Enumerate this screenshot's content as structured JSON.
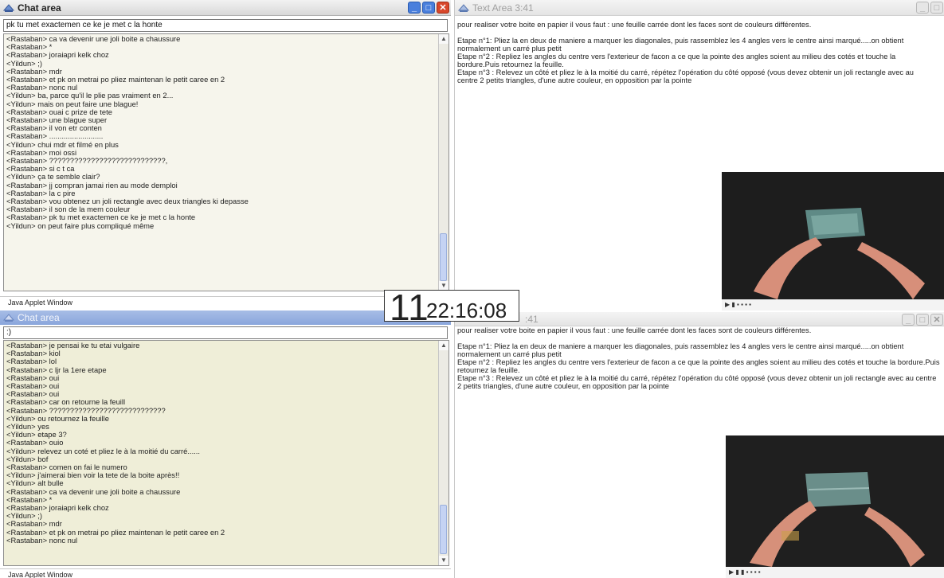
{
  "chat_top": {
    "title": "Chat area",
    "input_value": "pk tu met exactemen ce ke je met c la honte",
    "messages": [
      "<Rastaban> ca va devenir une joli boite a chaussure",
      "<Rastaban> *",
      "<Rastaban> joraiapri kelk choz",
      "<Yildun> ;)",
      "<Rastaban> mdr",
      "<Rastaban> et pk on metrai po pliez maintenan le petit caree en 2",
      "<Rastaban> nonc nul",
      "<Yildun> ba, parce qu'il le plie pas vraiment en 2...",
      "<Yildun> mais on peut faire une blague!",
      "<Rastaban> ouai c prize de tete",
      "<Rastaban> une blague super",
      "<Rastaban> il von etr conten",
      "<Rastaban> ..........................",
      "<Yildun> chui mdr et filmé en plus",
      "<Rastaban> moi ossi",
      "<Rastaban> ????????????????????????????,",
      "<Rastaban> si c t ca",
      "<Yildun> ça te semble clair?",
      "<Rastaban> jj compran jamai rien au mode demploi",
      "<Rastaban> la c pire",
      "<Rastaban> vou obtenez un joli rectangle avec deux triangles ki depasse",
      "<Rastaban> il son de la mem couleur",
      "<Rastaban> pk tu met exactemen ce ke je met c la honte",
      "<Yildun> on peut faire plus compliqué même"
    ],
    "status": "Java Applet Window"
  },
  "chat_bottom": {
    "title": "Chat area",
    "input_value": ":)",
    "messages": [
      "<Rastaban> je pensai ke tu etai vulgaire",
      "<Rastaban> kiol",
      "<Rastaban> lol",
      "<Rastaban> c ljr la 1ere etape",
      "<Rastaban> oui",
      "<Rastaban> oui",
      "<Rastaban> oui",
      "<Rastaban> car on retourne la feuill",
      "<Rastaban> ????????????????????????????",
      "<Yildun> ou retournez la feuille",
      "<Yildun> yes",
      "<Yildun> etape 3?",
      "<Rastaban> ouio",
      "<Yildun> relevez un coté et pliez le à la moitié du carré......",
      "<Yildun> bof",
      "<Rastaban> comen on fai le numero",
      "<Yildun> j'aimerai bien voir la tete de la boite après!!",
      "<Yildun> alt bulle",
      "<Rastaban> ca va devenir une joli boite a chaussure",
      "<Rastaban> *",
      "<Rastaban> joraiapri kelk choz",
      "<Yildun> ;)",
      "<Rastaban> mdr",
      "<Rastaban> et pk on metrai po pliez maintenan le petit caree en 2",
      "<Rastaban> nonc nul"
    ],
    "status": "Java Applet Window"
  },
  "text_top": {
    "title": "Text Area 3:41",
    "paragraphs": [
      "pour realiser votre boite en papier il vous faut : une feuille carrée dont les faces sont de couleurs différentes.",
      "",
      "Etape n°1: Pliez  la en deux de maniere a marquer les diagonales, puis rassemblez les 4 angles vers le centre ainsi marqué.....on obtient normalement un carré plus petit",
      "Etape n°2 : Repliez les angles du centre vers l'exterieur de facon a ce que la pointe des angles soient au milieu des cotés  et touche la bordure.Puis retournez la feuille.",
      "Etape n°3 : Relevez un côté et pliez le à la moitié du carré, répétez l'opération du côté opposé (vous devez obtenir un joli rectangle avec au centre 2 petits triangles, d'une autre couleur, en opposition par la pointe"
    ]
  },
  "text_bottom": {
    "title_fragment": ":41",
    "paragraphs": [
      "pour realiser votre boite en papier il vous faut : une feuille carrée dont les faces sont de couleurs différentes.",
      "",
      "Etape n°1: Pliez  la en deux de maniere a marquer les diagonales, puis rassemblez les 4 angles vers le centre ainsi marqué.....on obtient normalement un carré plus petit",
      "Etape n°2 : Repliez les angles du centre vers l'exterieur de facon a ce que la pointe des angles soient au milieu des cotés  et touche la bordure.Puis retournez la feuille.",
      "Etape n°3 : Relevez un côté et pliez le à la moitié du carré, répétez l'opération du côté opposé (vous devez obtenir un joli rectangle avec au centre 2 petits triangles, d'une autre couleur, en opposition par la pointe"
    ]
  },
  "clock": {
    "big": "11",
    "small": "22:16:08"
  },
  "colors": {
    "chat_bg_top": "#f6f5ec",
    "chat_bg_bottom": "#efeed8",
    "titlebar_active": "#d8d8d8",
    "titlebar_inactive": "#8aa6dc"
  },
  "icons": [
    "app-window-icon",
    "minimize-icon",
    "maximize-icon",
    "close-icon",
    "scroll-up-icon",
    "scroll-down-icon",
    "play-icon"
  ]
}
